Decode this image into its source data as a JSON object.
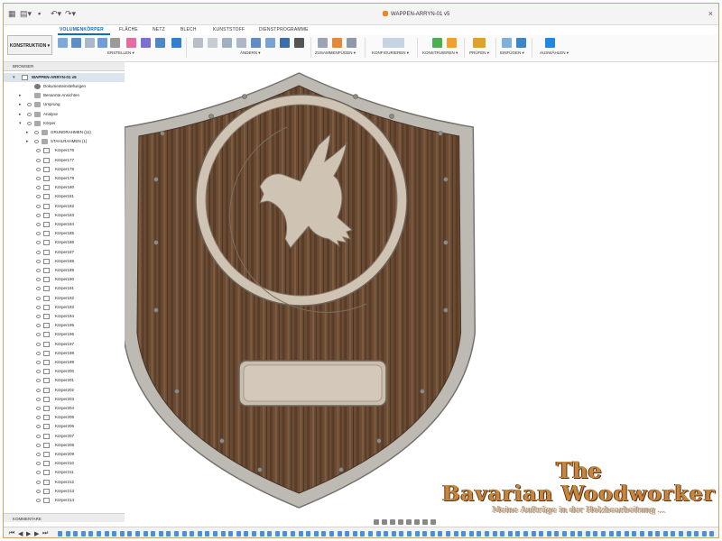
{
  "window": {
    "title": "WAPPEN-ARRYN-01 v5"
  },
  "ribbon_tabs": [
    {
      "label": "VOLUMENKÖRPER",
      "active": true
    },
    {
      "label": "FLÄCHE",
      "active": false
    },
    {
      "label": "NETZ",
      "active": false
    },
    {
      "label": "BLECH",
      "active": false
    },
    {
      "label": "KUNSTSTOFF",
      "active": false
    },
    {
      "label": "DIENSTPROGRAMME",
      "active": false
    }
  ],
  "workspace_label": "KONSTRUKTION ▾",
  "toolbar_groups": [
    {
      "label": "ERSTELLEN ▾"
    },
    {
      "label": "ÄNDERN ▾"
    },
    {
      "label": "ZUSAMMENFÜGEN ▾"
    },
    {
      "label": "KONFIGURIEREN ▾"
    },
    {
      "label": "KONSTRUIEREN ▾"
    },
    {
      "label": "PRÜFEN ▾"
    },
    {
      "label": "EINFÜGEN ▾"
    },
    {
      "label": "AUSWÄHLEN ▾"
    }
  ],
  "browser": {
    "header": "BROWSER",
    "document": "WAPPEN-ARRYN-01 v5",
    "top_items": [
      {
        "label": "Dokumenteinstellungen",
        "icon": "gear-icon"
      },
      {
        "label": "Benannte Ansichten",
        "icon": "folder-icon"
      },
      {
        "label": "Ursprung",
        "icon": "folder-icon"
      },
      {
        "label": "Analyse",
        "icon": "folder-icon"
      },
      {
        "label": "Körper",
        "icon": "folder-icon"
      },
      {
        "label": "GRUNDRAHMEN (11)",
        "icon": "folder-icon"
      },
      {
        "label": "STAHLRAHMEN (1)",
        "icon": "folder-icon"
      }
    ],
    "bodies": [
      "Körper176",
      "Körper177",
      "Körper178",
      "Körper179",
      "Körper180",
      "Körper181",
      "Körper182",
      "Körper183",
      "Körper184",
      "Körper185",
      "Körper186",
      "Körper187",
      "Körper188",
      "Körper189",
      "Körper190",
      "Körper191",
      "Körper192",
      "Körper193",
      "Körper194",
      "Körper195",
      "Körper196",
      "Körper197",
      "Körper198",
      "Körper199",
      "Körper200",
      "Körper201",
      "Körper202",
      "Körper203",
      "Körper204",
      "Körper205",
      "Körper206",
      "Körper207",
      "Körper208",
      "Körper209",
      "Körper210",
      "Körper211",
      "Körper212",
      "Körper213",
      "Körper214"
    ],
    "comments_label": "KOMMENTARE"
  },
  "watermark": {
    "line1": "The",
    "line2": "Bavarian Woodworker",
    "line3": "Meine Aufträge in der Holzbearbeitung ..."
  },
  "colors": {
    "accent": "#0a6fc2",
    "wood_dark": "#5b3f2a",
    "wood_light": "#7a5a40",
    "inlay": "#cfc3b3",
    "frame": "#bdbab4",
    "watermark": "#c7853d"
  }
}
